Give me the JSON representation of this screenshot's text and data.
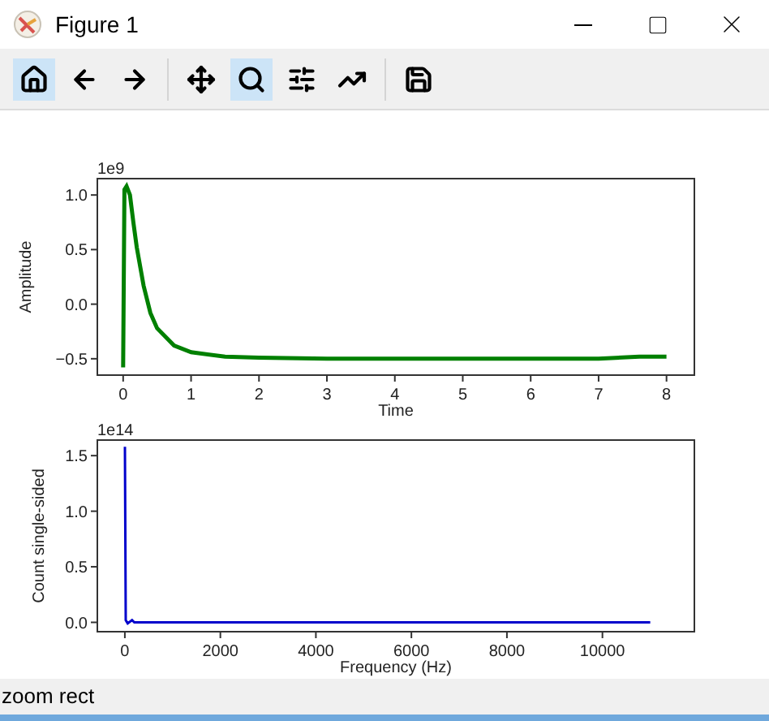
{
  "window": {
    "title": "Figure 1"
  },
  "toolbar": {
    "groups": [
      {
        "tools": [
          {
            "kind": "home",
            "selected": true
          },
          {
            "kind": "back",
            "selected": false
          },
          {
            "kind": "forward",
            "selected": false
          }
        ]
      },
      {
        "tools": [
          {
            "kind": "pan",
            "selected": false
          },
          {
            "kind": "zoom",
            "selected": true
          },
          {
            "kind": "configure",
            "selected": false
          },
          {
            "kind": "edit",
            "selected": false
          }
        ]
      },
      {
        "tools": [
          {
            "kind": "save",
            "selected": false
          }
        ]
      }
    ]
  },
  "figure": {
    "axes": [
      {
        "offset_text": "1e9",
        "chart_data": {
          "type": "line",
          "xlabel": "Time",
          "ylabel": "Amplitude",
          "xlim": [
            -0.38,
            8.41
          ],
          "ylim": [
            -0.65,
            1.15
          ],
          "xticks": [
            0,
            1,
            2,
            3,
            4,
            5,
            6,
            7,
            8
          ],
          "yticks": [
            {
              "value": -0.5,
              "label": "−0.5"
            },
            {
              "value": 0,
              "label": "0.0"
            },
            {
              "value": 0.5,
              "label": "0.5"
            },
            {
              "value": 1,
              "label": "1.0"
            }
          ],
          "x": [
            0,
            0.02,
            0.05,
            0.1,
            0.15,
            0.2,
            0.3,
            0.4,
            0.5,
            0.75,
            1,
            1.5,
            2,
            3,
            4,
            5,
            6,
            7,
            7.6,
            8
          ],
          "series": [
            {
              "color": "#008000",
              "values": [
                -0.58,
                1.05,
                1.08,
                1.0,
                0.75,
                0.52,
                0.17,
                -0.08,
                -0.22,
                -0.38,
                -0.44,
                -0.48,
                -0.49,
                -0.5,
                -0.5,
                -0.5,
                -0.5,
                -0.5,
                -0.48,
                -0.48
              ]
            }
          ]
        }
      },
      {
        "offset_text": "1e14",
        "chart_data": {
          "type": "line",
          "xlabel": "Frequency (Hz)",
          "ylabel": "Count single-sided",
          "xlim": [
            -576,
            11925
          ],
          "ylim": [
            -0.084,
            1.64
          ],
          "xticks": [
            0,
            2000,
            4000,
            6000,
            8000,
            10000
          ],
          "yticks": [
            {
              "value": 0,
              "label": "0.0"
            },
            {
              "value": 0.5,
              "label": "0.5"
            },
            {
              "value": 1,
              "label": "1.0"
            },
            {
              "value": 1.5,
              "label": "1.5"
            }
          ],
          "x": [
            0,
            20,
            60,
            150,
            200,
            1000,
            11000
          ],
          "series": [
            {
              "color": "#0000cc",
              "values": [
                1.58,
                0.02,
                -0.01,
                0.02,
                0,
                0,
                0
              ]
            }
          ]
        }
      }
    ]
  },
  "status_bar": {
    "message": "zoom rect"
  }
}
